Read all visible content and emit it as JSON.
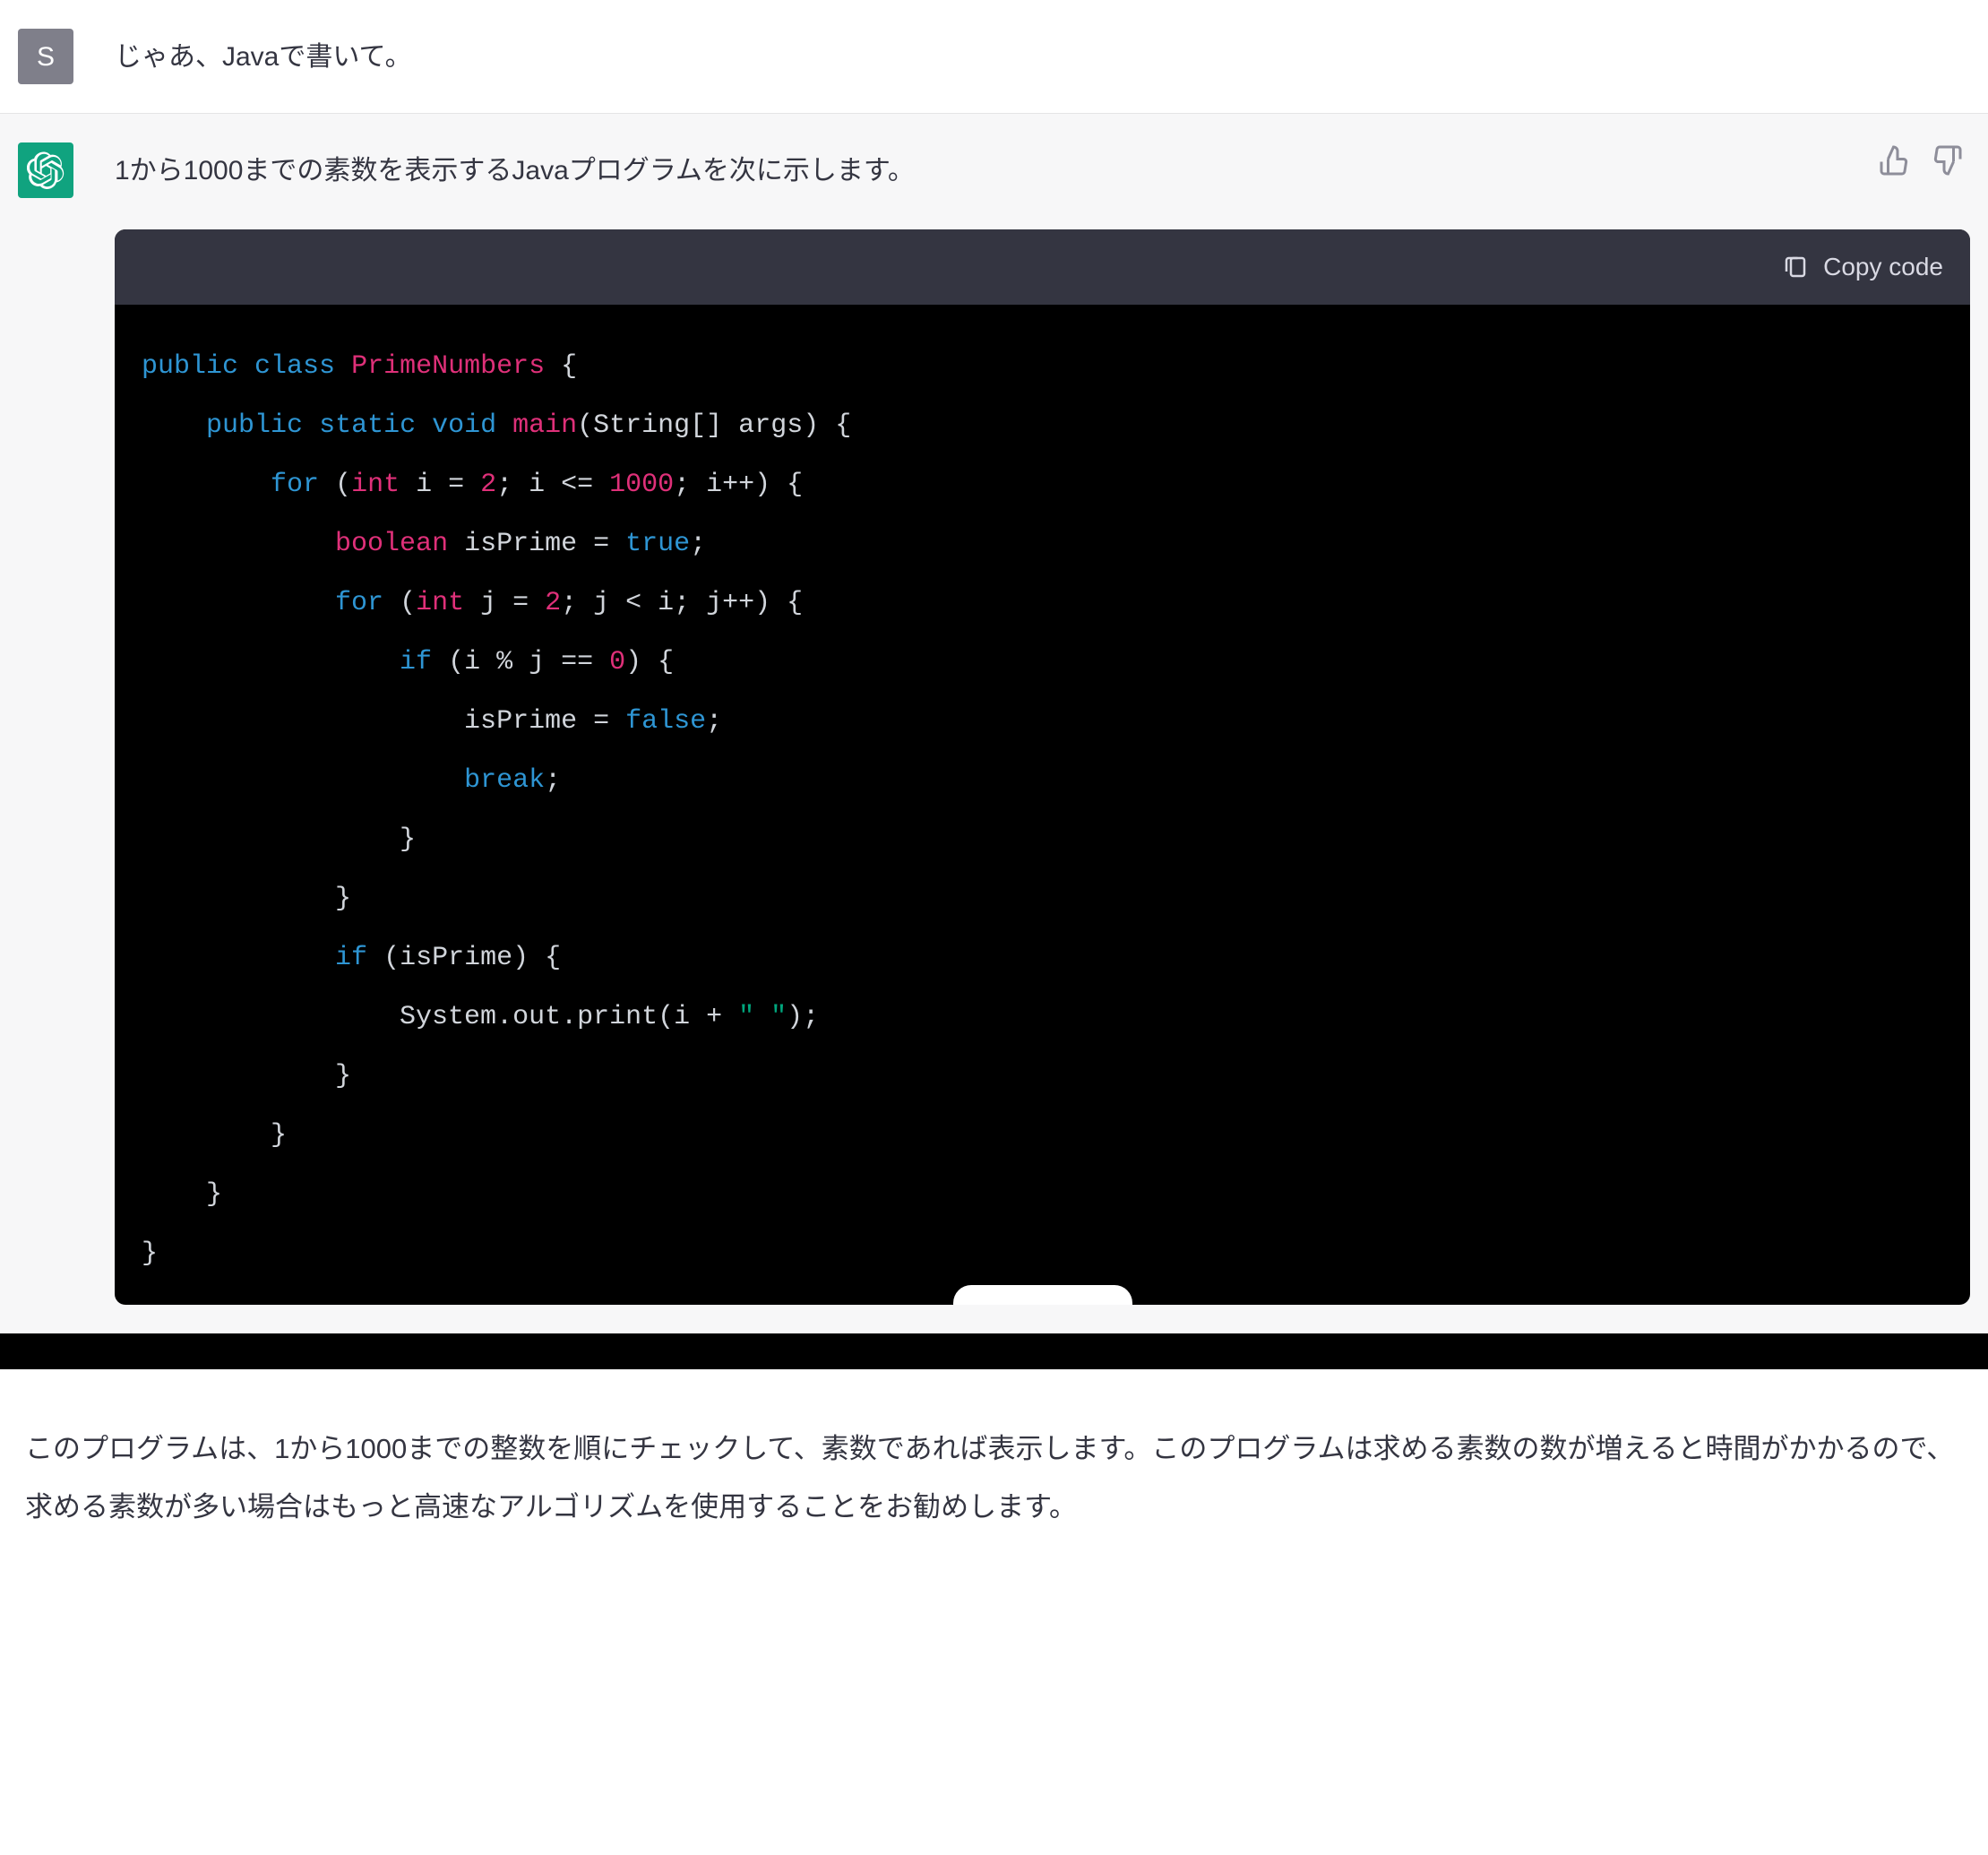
{
  "user": {
    "avatar_letter": "S",
    "message": "じゃあ、Javaで書いて。"
  },
  "assistant": {
    "intro": "1から1000までの素数を表示するJavaプログラムを次に示します。",
    "copy_label": "Copy code",
    "code": {
      "tokens": [
        [
          [
            "kw1",
            "public"
          ],
          [
            "sp",
            " "
          ],
          [
            "kw1",
            "class"
          ],
          [
            "sp",
            " "
          ],
          [
            "class",
            "PrimeNumbers"
          ],
          [
            "pl",
            " {"
          ]
        ],
        [
          [
            "pl",
            "    "
          ],
          [
            "kw1",
            "public"
          ],
          [
            "sp",
            " "
          ],
          [
            "kw1",
            "static"
          ],
          [
            "sp",
            " "
          ],
          [
            "kw1",
            "void"
          ],
          [
            "sp",
            " "
          ],
          [
            "fn",
            "main"
          ],
          [
            "pl",
            "(String[] args) {"
          ]
        ],
        [
          [
            "pl",
            "        "
          ],
          [
            "kw2",
            "for"
          ],
          [
            "pl",
            " ("
          ],
          [
            "type",
            "int"
          ],
          [
            "pl",
            " i = "
          ],
          [
            "num",
            "2"
          ],
          [
            "pl",
            "; i <= "
          ],
          [
            "num",
            "1000"
          ],
          [
            "pl",
            "; i++) {"
          ]
        ],
        [
          [
            "pl",
            "            "
          ],
          [
            "type",
            "boolean"
          ],
          [
            "pl",
            " isPrime = "
          ],
          [
            "bool",
            "true"
          ],
          [
            "pl",
            ";"
          ]
        ],
        [
          [
            "pl",
            "            "
          ],
          [
            "kw2",
            "for"
          ],
          [
            "pl",
            " ("
          ],
          [
            "type",
            "int"
          ],
          [
            "pl",
            " j = "
          ],
          [
            "num",
            "2"
          ],
          [
            "pl",
            "; j < i; j++) {"
          ]
        ],
        [
          [
            "pl",
            "                "
          ],
          [
            "kw2",
            "if"
          ],
          [
            "pl",
            " (i % j == "
          ],
          [
            "num",
            "0"
          ],
          [
            "pl",
            ") {"
          ]
        ],
        [
          [
            "pl",
            "                    isPrime = "
          ],
          [
            "bool",
            "false"
          ],
          [
            "pl",
            ";"
          ]
        ],
        [
          [
            "pl",
            "                    "
          ],
          [
            "kw2",
            "break"
          ],
          [
            "pl",
            ";"
          ]
        ],
        [
          [
            "pl",
            "                }"
          ]
        ],
        [
          [
            "pl",
            "            }"
          ]
        ],
        [
          [
            "pl",
            "            "
          ],
          [
            "kw2",
            "if"
          ],
          [
            "pl",
            " (isPrime) {"
          ]
        ],
        [
          [
            "pl",
            "                System.out.print(i + "
          ],
          [
            "str",
            "\" \""
          ],
          [
            "pl",
            ");"
          ]
        ],
        [
          [
            "pl",
            "            }"
          ]
        ],
        [
          [
            "pl",
            "        }"
          ]
        ],
        [
          [
            "pl",
            "    }"
          ]
        ],
        [
          [
            "pl",
            "}"
          ]
        ]
      ]
    },
    "explanation": "このプログラムは、1から1000までの整数を順にチェックして、素数であれば表示します。このプログラムは求める素数の数が増えると時間がかかるので、求める素数が多い場合はもっと高速なアルゴリズムを使用することをお勧めします。"
  }
}
